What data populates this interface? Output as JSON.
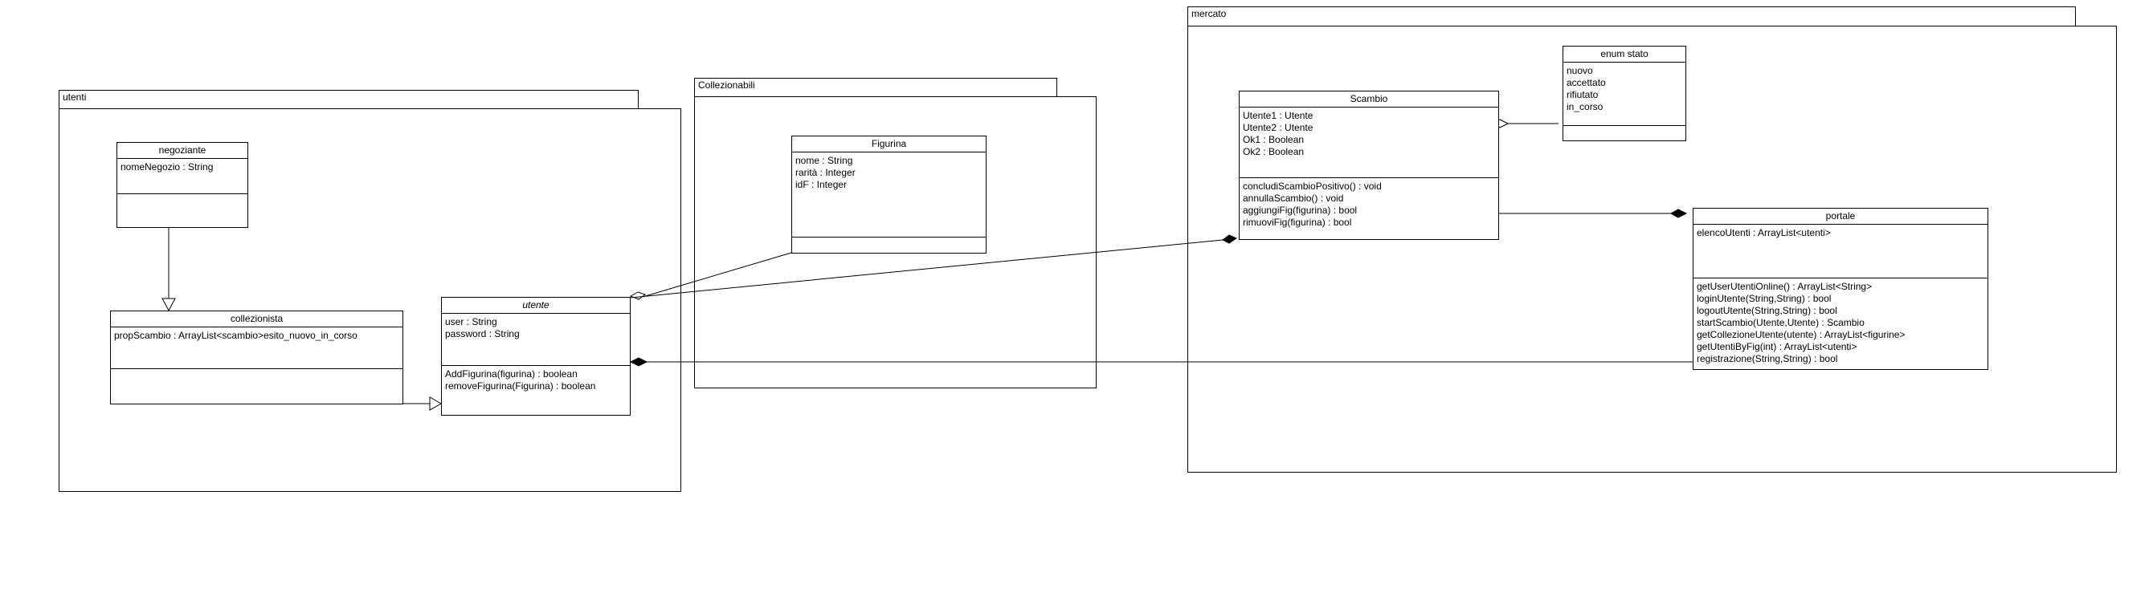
{
  "packages": {
    "utenti": "utenti",
    "collezionabili": "Collezionabili",
    "mercato": "mercato"
  },
  "classes": {
    "negoziante": {
      "name": "negoziante",
      "attributes": [
        "nomeNegozio : String"
      ],
      "operations": []
    },
    "collezionista": {
      "name": "collezionista",
      "attributes": [
        "propScambio : ArrayList<scambio>esito_nuovo_in_corso"
      ],
      "operations": []
    },
    "utente": {
      "name": "utente",
      "attributes": [
        "user : String",
        "password : String"
      ],
      "operations": [
        "AddFigurina(figurina) : boolean",
        "removeFigurina(Figurina) : boolean"
      ]
    },
    "figurina": {
      "name": "Figurina",
      "attributes": [
        "nome : String",
        "rarità : Integer",
        "idF : Integer"
      ],
      "operations": []
    },
    "scambio": {
      "name": "Scambio",
      "attributes": [
        "Utente1 : Utente",
        "Utente2 : Utente",
        "Ok1 : Boolean",
        "Ok2 : Boolean"
      ],
      "operations": [
        "concludiScambioPositivo() : void",
        "annullaScambio() : void",
        "aggiungiFig(figurina) : bool",
        "rimuoviFig(figurina) : bool"
      ]
    },
    "enum_stato": {
      "name": "enum stato",
      "attributes": [
        "nuovo",
        "accettato",
        "rifiutato",
        "in_corso"
      ],
      "operations": []
    },
    "portale": {
      "name": "portale",
      "attributes": [
        "elencoUtenti : ArrayList<utenti>"
      ],
      "operations": [
        "getUserUtentiOnline() : ArrayList<String>",
        "loginUtente(String,String) : bool",
        "logoutUtente(String,String) : bool",
        "startScambio(Utente,Utente) : Scambio",
        "getCollezioneUtente(utente) : ArrayList<figurine>",
        "getUtentiByFig(int) : ArrayList<utenti>",
        "registrazione(String,String) : bool"
      ]
    }
  }
}
